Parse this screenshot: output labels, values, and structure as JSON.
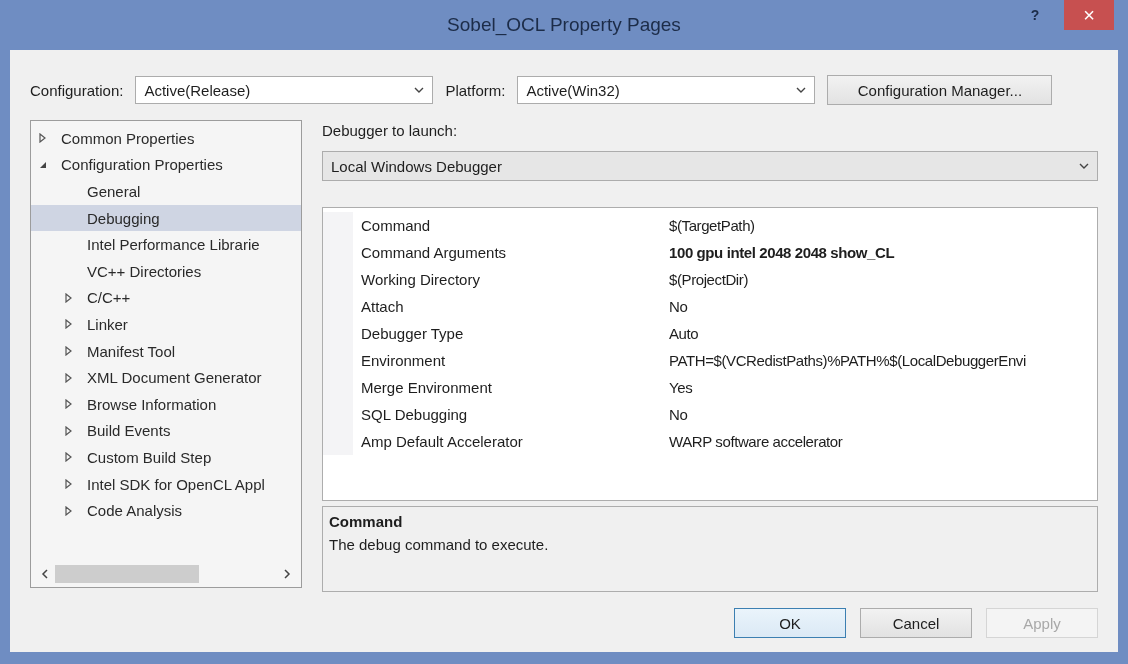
{
  "window": {
    "title": "Sobel_OCL Property Pages",
    "help": "?",
    "close": "×"
  },
  "configuration": {
    "label": "Configuration:",
    "value": "Active(Release)"
  },
  "platform": {
    "label": "Platform:",
    "value": "Active(Win32)"
  },
  "configuration_manager": "Configuration Manager...",
  "tree": [
    {
      "label": "Common Properties",
      "kind": "group",
      "expanded": false,
      "selected": false
    },
    {
      "label": "Configuration Properties",
      "kind": "group",
      "expanded": true,
      "selected": false,
      "children": [
        {
          "label": "General",
          "kind": "page",
          "selected": false
        },
        {
          "label": "Debugging",
          "kind": "page",
          "selected": true
        },
        {
          "label": "Intel Performance Librarie",
          "kind": "page",
          "selected": false
        },
        {
          "label": "VC++ Directories",
          "kind": "page",
          "selected": false
        },
        {
          "label": "C/C++",
          "kind": "group",
          "expanded": false,
          "selected": false
        },
        {
          "label": "Linker",
          "kind": "group",
          "expanded": false,
          "selected": false
        },
        {
          "label": "Manifest Tool",
          "kind": "group",
          "expanded": false,
          "selected": false
        },
        {
          "label": "XML Document Generator",
          "kind": "group",
          "expanded": false,
          "selected": false
        },
        {
          "label": "Browse Information",
          "kind": "group",
          "expanded": false,
          "selected": false
        },
        {
          "label": "Build Events",
          "kind": "group",
          "expanded": false,
          "selected": false
        },
        {
          "label": "Custom Build Step",
          "kind": "group",
          "expanded": false,
          "selected": false
        },
        {
          "label": "Intel SDK for OpenCL Appl",
          "kind": "group",
          "expanded": false,
          "selected": false
        },
        {
          "label": "Code Analysis",
          "kind": "group",
          "expanded": false,
          "selected": false
        }
      ]
    }
  ],
  "debugger": {
    "label": "Debugger to launch:",
    "value": "Local Windows Debugger"
  },
  "properties": [
    {
      "name": "Command",
      "value": "$(TargetPath)",
      "bold": false
    },
    {
      "name": "Command Arguments",
      "value": "100 gpu intel 2048 2048 show_CL",
      "bold": true
    },
    {
      "name": "Working Directory",
      "value": "$(ProjectDir)",
      "bold": false
    },
    {
      "name": "Attach",
      "value": "No",
      "bold": false
    },
    {
      "name": "Debugger Type",
      "value": "Auto",
      "bold": false
    },
    {
      "name": "Environment",
      "value": "PATH=$(VCRedistPaths)%PATH%$(LocalDebuggerEnvi",
      "bold": false
    },
    {
      "name": "Merge Environment",
      "value": "Yes",
      "bold": false
    },
    {
      "name": "SQL Debugging",
      "value": "No",
      "bold": false
    },
    {
      "name": "Amp Default Accelerator",
      "value": "WARP software accelerator",
      "bold": false
    }
  ],
  "description": {
    "title": "Command",
    "text": "The debug command to execute."
  },
  "buttons": [
    {
      "label": "OK",
      "default": true,
      "disabled": false
    },
    {
      "label": "Cancel",
      "default": false,
      "disabled": false
    },
    {
      "label": "Apply",
      "default": false,
      "disabled": true
    }
  ]
}
